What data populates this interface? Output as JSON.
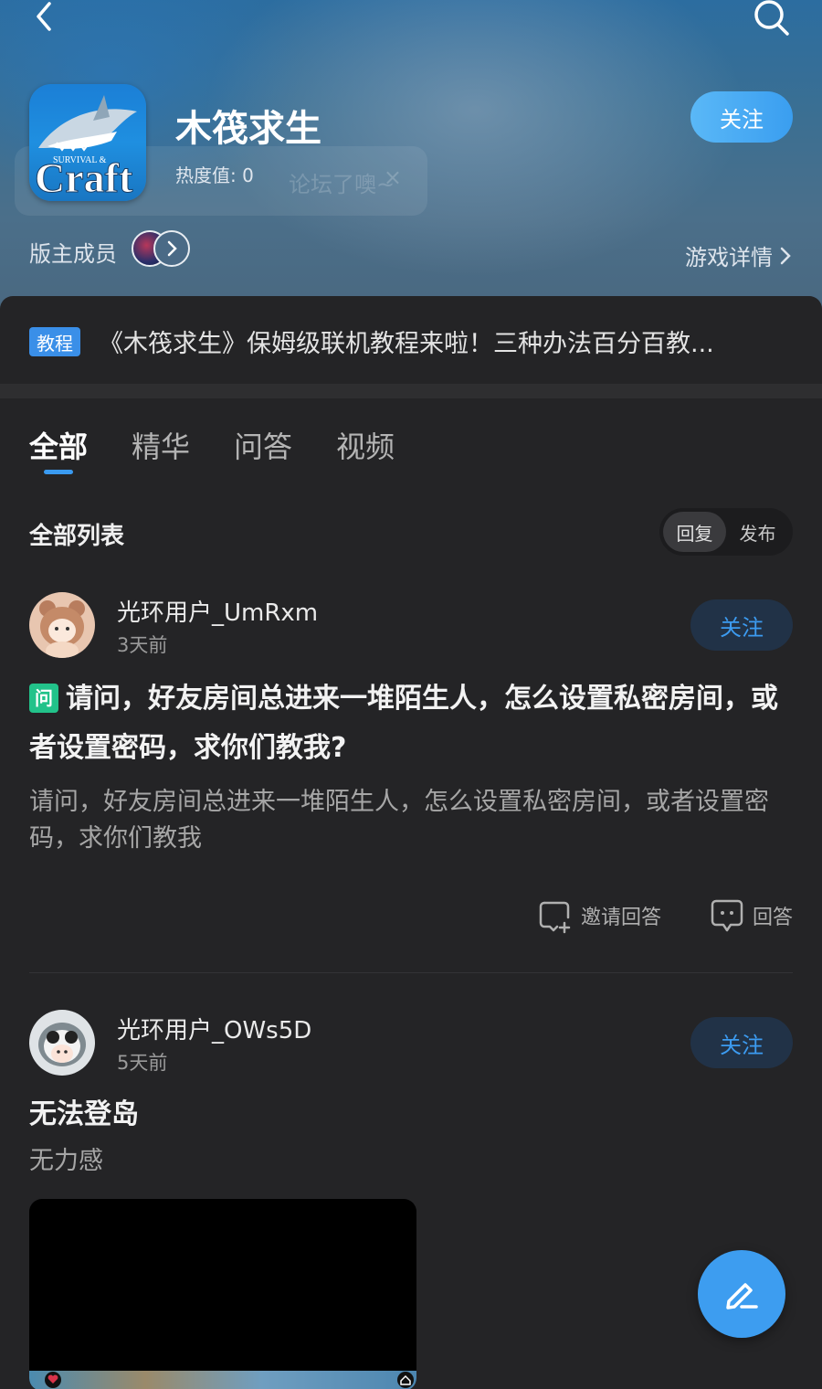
{
  "header": {
    "game_title": "木筏求生",
    "heat_label": "热度值:",
    "heat_value": "0",
    "follow_label": "关注",
    "moderators_label": "版主成员",
    "game_detail_label": "游戏详情",
    "ghost_toast": "论坛了噢~",
    "logo_text_small": "SURVIVAL &",
    "logo_text_big": "Craft"
  },
  "notice": {
    "tag": "教程",
    "text": "《木筏求生》保姆级联机教程来啦！三种办法百分百教..."
  },
  "tabs": [
    {
      "label": "全部",
      "active": true
    },
    {
      "label": "精华",
      "active": false
    },
    {
      "label": "问答",
      "active": false
    },
    {
      "label": "视频",
      "active": false
    }
  ],
  "list": {
    "title": "全部列表",
    "sort_options": [
      "回复",
      "发布"
    ],
    "sort_selected": "回复"
  },
  "posts": [
    {
      "username": "光环用户_UmRxm",
      "time": "3天前",
      "follow_label": "关注",
      "badge": "问",
      "title": "请问，好友房间总进来一堆陌生人，怎么设置私密房间，或者设置密码，求你们教我?",
      "body": "请问，好友房间总进来一堆陌生人，怎么设置私密房间，或者设置密码，求你们教我",
      "invite_label": "邀请回答",
      "answer_label": "回答"
    },
    {
      "username": "光环用户_OWs5D",
      "time": "5天前",
      "follow_label": "关注",
      "title": "无法登岛",
      "body": "无力感"
    }
  ],
  "colors": {
    "accent": "#3a9af0",
    "background": "#242426",
    "question_badge": "#22c28a"
  }
}
